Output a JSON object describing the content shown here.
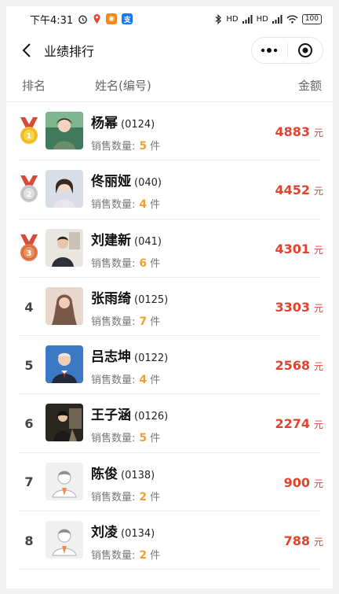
{
  "status_bar": {
    "time": "下午4:31",
    "signal_1": "HD",
    "signal_2": "HD",
    "battery": "100"
  },
  "nav": {
    "title": "业绩排行"
  },
  "header": {
    "rank": "排名",
    "name": "姓名(编号)",
    "amount": "金额"
  },
  "colors": {
    "amount_red": "#e2432e",
    "quantity_orange": "#f0a030",
    "gold": "#f2c12e",
    "silver": "#c9c9c9",
    "bronze": "#e07a4a",
    "ribbon": "#d9493a"
  },
  "rows": [
    {
      "rank": "1",
      "name": "杨幂",
      "code": "(0124)",
      "sales_label": "销售数量:",
      "qty": "5",
      "unit": "件",
      "amount": "4883",
      "currency": "元"
    },
    {
      "rank": "2",
      "name": "佟丽娅",
      "code": "(040)",
      "sales_label": "销售数量:",
      "qty": "4",
      "unit": "件",
      "amount": "4452",
      "currency": "元"
    },
    {
      "rank": "3",
      "name": "刘建新",
      "code": "(041)",
      "sales_label": "销售数量:",
      "qty": "6",
      "unit": "件",
      "amount": "4301",
      "currency": "元"
    },
    {
      "rank": "4",
      "name": "张雨绮",
      "code": "(0125)",
      "sales_label": "销售数量:",
      "qty": "7",
      "unit": "件",
      "amount": "3303",
      "currency": "元"
    },
    {
      "rank": "5",
      "name": "吕志坤",
      "code": "(0122)",
      "sales_label": "销售数量:",
      "qty": "4",
      "unit": "件",
      "amount": "2568",
      "currency": "元"
    },
    {
      "rank": "6",
      "name": "王子涵",
      "code": "(0126)",
      "sales_label": "销售数量:",
      "qty": "5",
      "unit": "件",
      "amount": "2274",
      "currency": "元"
    },
    {
      "rank": "7",
      "name": "陈俊",
      "code": "(0138)",
      "sales_label": "销售数量:",
      "qty": "2",
      "unit": "件",
      "amount": "900",
      "currency": "元"
    },
    {
      "rank": "8",
      "name": "刘凌",
      "code": "(0134)",
      "sales_label": "销售数量:",
      "qty": "2",
      "unit": "件",
      "amount": "788",
      "currency": "元"
    }
  ]
}
